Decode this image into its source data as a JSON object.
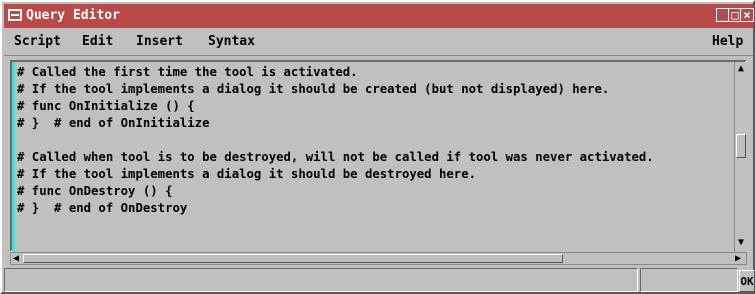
{
  "window": {
    "title": "Query Editor",
    "title_bar_color": "#b84a4a",
    "controls": {
      "minimize": "minimize-icon",
      "maximize": "maximize-icon",
      "close": "close-icon"
    }
  },
  "menu": {
    "items": [
      "Script",
      "Edit",
      "Insert",
      "Syntax"
    ],
    "help": "Help"
  },
  "editor": {
    "lines": [
      "# Called the first time the tool is activated.",
      "# If the tool implements a dialog it should be created (but not displayed) here.",
      "# func OnInitialize () {",
      "# }  # end of OnInitialize",
      "",
      "# Called when tool is to be destroyed, will not be called if tool was never activated.",
      "# If the tool implements a dialog it should be destroyed here.",
      "# func OnDestroy () {",
      "# }  # end of OnDestroy"
    ],
    "margin_color": "#58d6d6"
  },
  "buttons": {
    "ok": "OK"
  }
}
